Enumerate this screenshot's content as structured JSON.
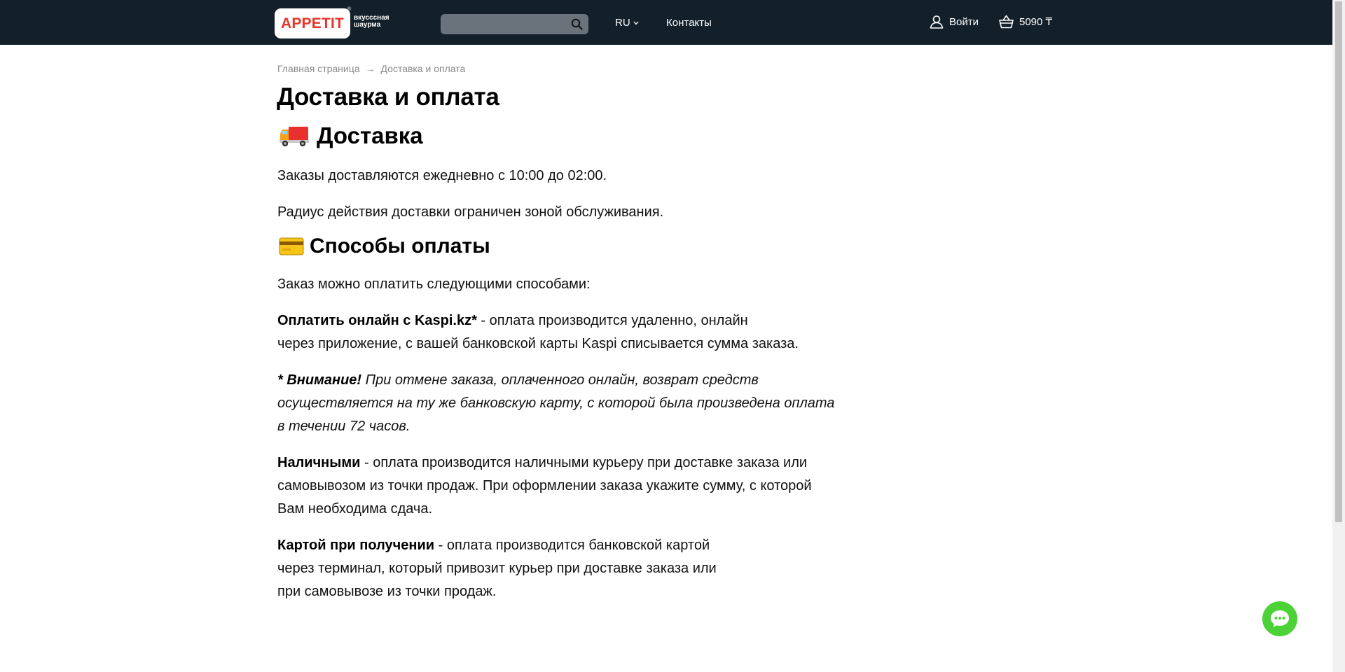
{
  "header": {
    "logo_text": "APPETIT",
    "logo_reg": "®",
    "tagline_line1": "вкусссная",
    "tagline_line2": "шаурма",
    "search_placeholder": "",
    "lang": "RU",
    "contacts": "Контакты",
    "login": "Войти",
    "cart_total": "5090 ₸"
  },
  "breadcrumb": {
    "home": "Главная страница",
    "separator": "→",
    "current": "Доставка и оплата"
  },
  "page": {
    "title": "Доставка и оплата",
    "delivery_heading": "Доставка",
    "delivery_p1": "Заказы доставляются ежедневно с 10:00 до 02:00.",
    "delivery_p2": "Радиус действия доставки ограничен зоной обслуживания.",
    "payment_heading": "Способы оплаты",
    "payment_intro": "Заказ можно оплатить следующими способами:",
    "kaspi_bold": "Оплатить онлайн с Kaspi.kz*",
    "kaspi_line1": " - оплата производится удаленно, онлайн",
    "kaspi_line2": "через приложение, с вашей банковской карты Kaspi списывается сумма заказа.",
    "note_bold": "* Внимание!",
    "note_line1": " При отмене заказа, оплаченного онлайн, возврат средств",
    "note_line2": "осуществляется на ту же банковскую карту, с которой была произведена оплата",
    "note_line3": "в течении 72 часов.",
    "cash_bold": "Наличными",
    "cash_line1": " - оплата производится наличными курьеру при доставке заказа или",
    "cash_line2": "самовывозом из точки продаж. При оформлении заказа укажите сумму, с которой",
    "cash_line3": "Вам необходима сдача.",
    "card_bold": "Картой при получении",
    "card_line1": " - оплата производится банковской картой",
    "card_line2": "через терминал, который привозит курьер при доставке заказа или",
    "card_line3": "при самовывозе из точки продаж."
  },
  "icons": {
    "delivery": "truck-icon",
    "payment": "credit-card-icon",
    "search": "search-icon",
    "login": "user-icon",
    "cart": "basket-icon",
    "chat": "chat-icon"
  },
  "colors": {
    "header_bg": "#13202a",
    "brand_red": "#e8352b",
    "chat_green": "#4cd137"
  }
}
